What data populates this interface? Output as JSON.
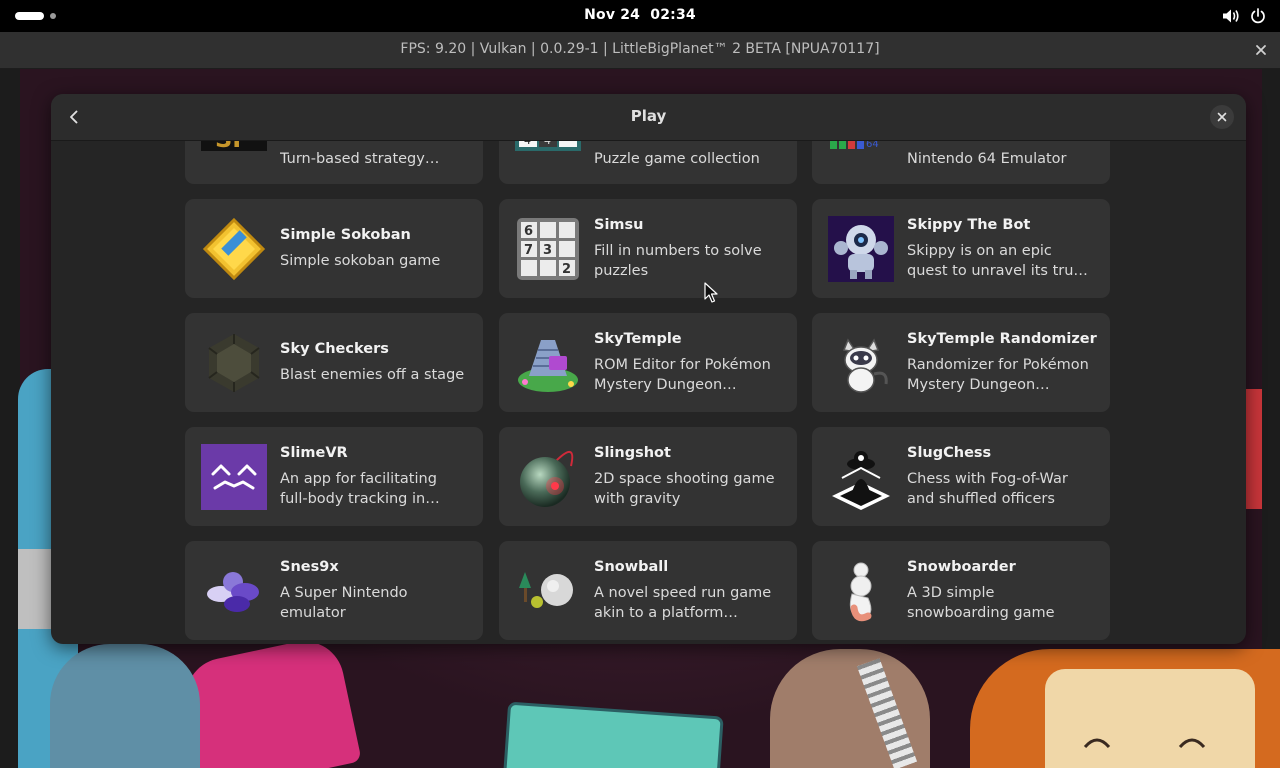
{
  "topbar": {
    "date": "Nov 24",
    "time": "02:34",
    "icons": [
      "volume-icon",
      "power-icon"
    ]
  },
  "window": {
    "title": "FPS: 9.20 | Vulkan | 0.0.29-1 | LittleBigPlanet™ 2 BETA [NPUA70117]"
  },
  "dialog": {
    "title": "Play"
  },
  "apps": [
    {
      "name": "",
      "desc": "Turn-based strategy game",
      "icon": "strategy-game-icon"
    },
    {
      "name": "",
      "desc": "Puzzle game collection",
      "icon": "puzzle-grid-icon"
    },
    {
      "name": "",
      "desc": "Nintendo 64 Emulator",
      "icon": "n64-icon"
    },
    {
      "name": "Simple Sokoban",
      "desc": "Simple sokoban game",
      "icon": "sokoban-icon"
    },
    {
      "name": "Simsu",
      "desc": "Fill in numbers to solve puzzles",
      "icon": "sudoku-icon"
    },
    {
      "name": "Skippy The Bot",
      "desc": "Skippy is on an epic quest to unravel its true destiny.",
      "icon": "robot-icon"
    },
    {
      "name": "Sky Checkers",
      "desc": "Blast enemies off a stage",
      "icon": "checkers-icon"
    },
    {
      "name": "SkyTemple",
      "desc": "ROM Editor for Pokémon Mystery Dungeon Explorers of Sky",
      "icon": "skytemple-icon"
    },
    {
      "name": "SkyTemple Randomizer",
      "desc": "Randomizer for Pokémon Mystery Dungeon Explorers of Sky",
      "icon": "randomizer-icon"
    },
    {
      "name": "SlimeVR",
      "desc": "An app for facilitating full-body tracking in virtual reality",
      "icon": "slimevr-icon"
    },
    {
      "name": "Slingshot",
      "desc": "2D space shooting game with gravity",
      "icon": "planet-icon"
    },
    {
      "name": "SlugChess",
      "desc": "Chess with Fog-of-War and shuffled officers",
      "icon": "chess-pawn-icon"
    },
    {
      "name": "Snes9x",
      "desc": "A Super Nintendo emulator",
      "icon": "snes-buttons-icon"
    },
    {
      "name": "Snowball",
      "desc": "A novel speed run game akin to a platform loop/board",
      "icon": "snowball-icon"
    },
    {
      "name": "Snowboarder",
      "desc": "A 3D simple snowboarding game",
      "icon": "snowman-icon"
    }
  ],
  "colors": {
    "dialog_bg": "#252525",
    "card_bg": "#333333",
    "titlebar_bg": "#303030",
    "slimevr_purple": "#6b3aa8"
  }
}
